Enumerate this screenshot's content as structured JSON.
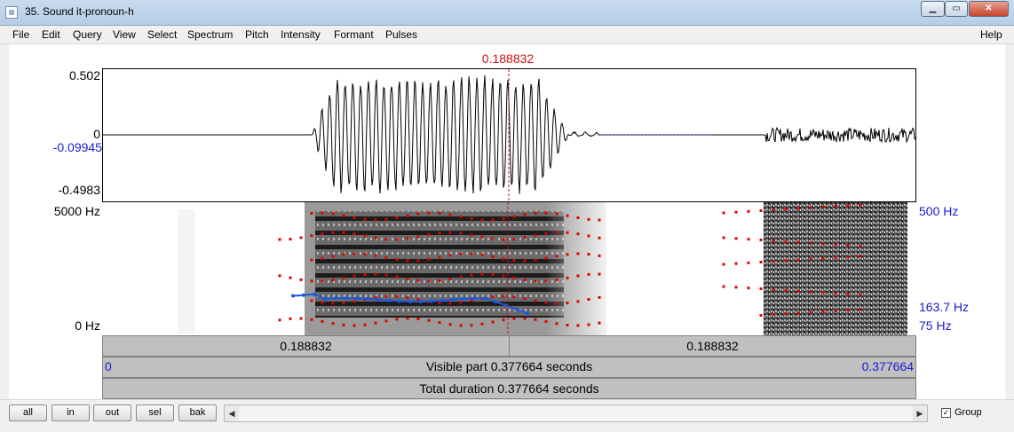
{
  "window": {
    "title": "35. Sound it-pronoun-h",
    "min_label": "▁",
    "max_label": "▭",
    "close_label": "✕"
  },
  "menu": [
    "File",
    "Edit",
    "Query",
    "View",
    "Select",
    "Spectrum",
    "Pitch",
    "Intensity",
    "Formant",
    "Pulses"
  ],
  "help": "Help",
  "cursor_time": "0.188832",
  "waveform": {
    "max": "0.502",
    "zero": "0",
    "mean": "-0.09945",
    "min": "-0.4983"
  },
  "spectrogram": {
    "top": "5000 Hz",
    "bottom": "0 Hz",
    "pitch_top": "500 Hz",
    "pitch_current": "163.7 Hz",
    "pitch_bottom": "75 Hz"
  },
  "selection": {
    "left": "0.188832",
    "right": "0.188832"
  },
  "visible": {
    "start": "0",
    "label": "Visible part 0.377664 seconds",
    "end": "0.377664"
  },
  "total": "Total duration 0.377664 seconds",
  "buttons": {
    "all": "all",
    "in": "in",
    "out": "out",
    "sel": "sel",
    "bak": "bak"
  },
  "group": {
    "label": "Group",
    "checked": "✓"
  },
  "colors": {
    "cursor": "#d01010",
    "pitch": "#1a5adc",
    "formant": "#e00000",
    "axis_blue": "#1a1acc"
  }
}
